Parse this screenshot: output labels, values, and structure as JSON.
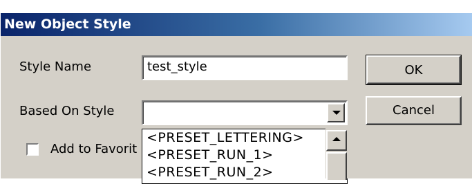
{
  "window": {
    "title": "New Object Style"
  },
  "form": {
    "style_name_label": "Style Name",
    "style_name_value": "test_style",
    "based_on_label": "Based On Style",
    "based_on_value": "",
    "favorites_label": "Add to Favorit"
  },
  "buttons": {
    "ok": "OK",
    "cancel": "Cancel"
  },
  "dropdown": {
    "items": [
      "<PRESET_LETTERING>",
      "<PRESET_RUN_1>",
      "<PRESET_RUN_2>"
    ]
  }
}
